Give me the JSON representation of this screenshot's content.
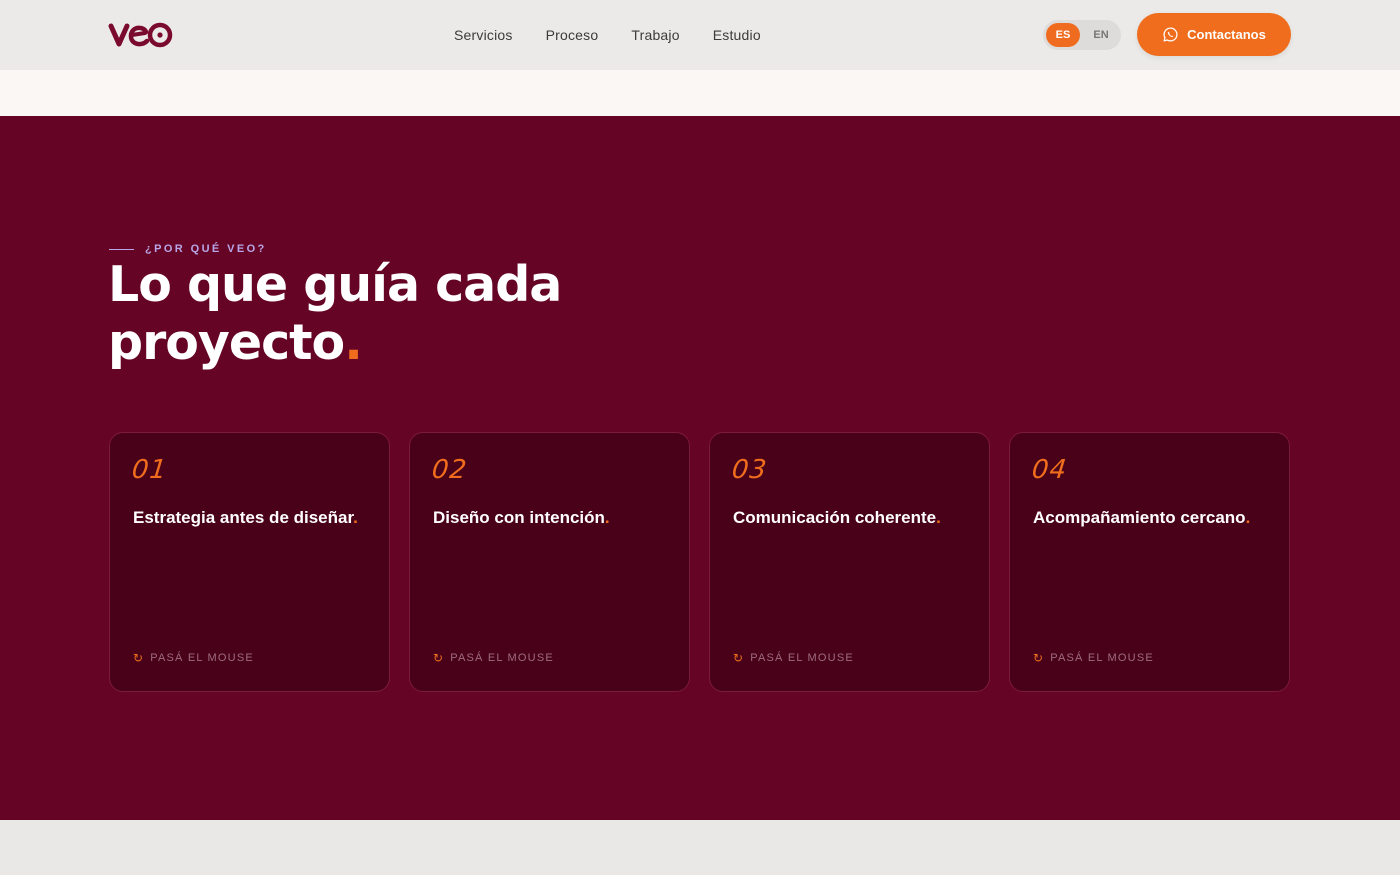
{
  "header": {
    "logo_text": "veo",
    "nav": [
      "Servicios",
      "Proceso",
      "Trabajo",
      "Estudio"
    ],
    "lang": {
      "active": "ES",
      "inactive": "EN"
    },
    "cta_label": "Contactanos"
  },
  "section": {
    "eyebrow": "¿POR QUÉ VEO?",
    "title_line1": "Lo que guía cada",
    "title_line2": "proyecto",
    "title_dot": ".",
    "cards": [
      {
        "num": "01",
        "title": "Estrategia antes de diseñar",
        "dot": ".",
        "hint": "PASÁ EL MOUSE"
      },
      {
        "num": "02",
        "title": "Diseño con intención",
        "dot": ".",
        "hint": "PASÁ EL MOUSE"
      },
      {
        "num": "03",
        "title": "Comunicación coherente",
        "dot": ".",
        "hint": "PASÁ EL MOUSE"
      },
      {
        "num": "04",
        "title": "Acompañamiento cercano",
        "dot": ".",
        "hint": "PASÁ EL MOUSE"
      }
    ]
  },
  "colors": {
    "accent": "#ef6d1c",
    "section_bg": "#660426",
    "card_bg": "#49011a",
    "eyebrow": "#b8a7e8"
  },
  "icons": {
    "cta": "whatsapp-icon",
    "hint": "rotate-icon"
  }
}
